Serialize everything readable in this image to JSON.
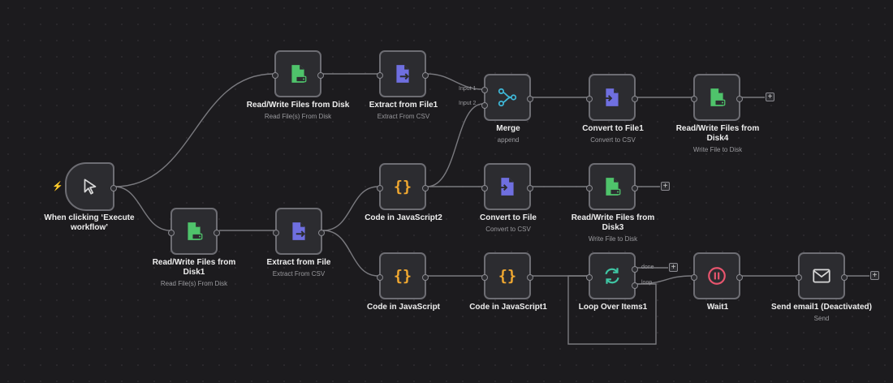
{
  "nodes": {
    "trigger": {
      "title": "When clicking ‘Execute workflow’"
    },
    "rw_disk": {
      "title": "Read/Write Files from Disk",
      "subtitle": "Read File(s) From Disk"
    },
    "extract_file1": {
      "title": "Extract from File1",
      "subtitle": "Extract From CSV"
    },
    "merge": {
      "title": "Merge",
      "subtitle": "append",
      "input1": "Input 1",
      "input2": "Input 2"
    },
    "convert_file1": {
      "title": "Convert to File1",
      "subtitle": "Convert to CSV"
    },
    "rw_disk4": {
      "title": "Read/Write Files from Disk4",
      "subtitle": "Write File to Disk"
    },
    "rw_disk1": {
      "title": "Read/Write Files from Disk1",
      "subtitle": "Read File(s) From Disk"
    },
    "extract_file": {
      "title": "Extract from File",
      "subtitle": "Extract From CSV"
    },
    "code_js2": {
      "title": "Code in JavaScript2"
    },
    "convert_file": {
      "title": "Convert to File",
      "subtitle": "Convert to CSV"
    },
    "rw_disk3": {
      "title": "Read/Write Files from Disk3",
      "subtitle": "Write File to Disk"
    },
    "code_js": {
      "title": "Code in JavaScript"
    },
    "code_js1": {
      "title": "Code in JavaScript1"
    },
    "loop": {
      "title": "Loop Over Items1",
      "done": "done",
      "loop": "loop"
    },
    "wait": {
      "title": "Wait1"
    },
    "email": {
      "title": "Send email1 (Deactivated)",
      "subtitle": "Send"
    }
  },
  "add_button": "+",
  "colors": {
    "file_green": "#4fc36b",
    "extract_purple": "#6f6fe0",
    "merge_cyan": "#3fb9d9",
    "code_orange": "#f0a830",
    "loop_teal": "#3fc6a4",
    "wait_pink": "#e8556e",
    "trigger_red": "#e0584f"
  }
}
